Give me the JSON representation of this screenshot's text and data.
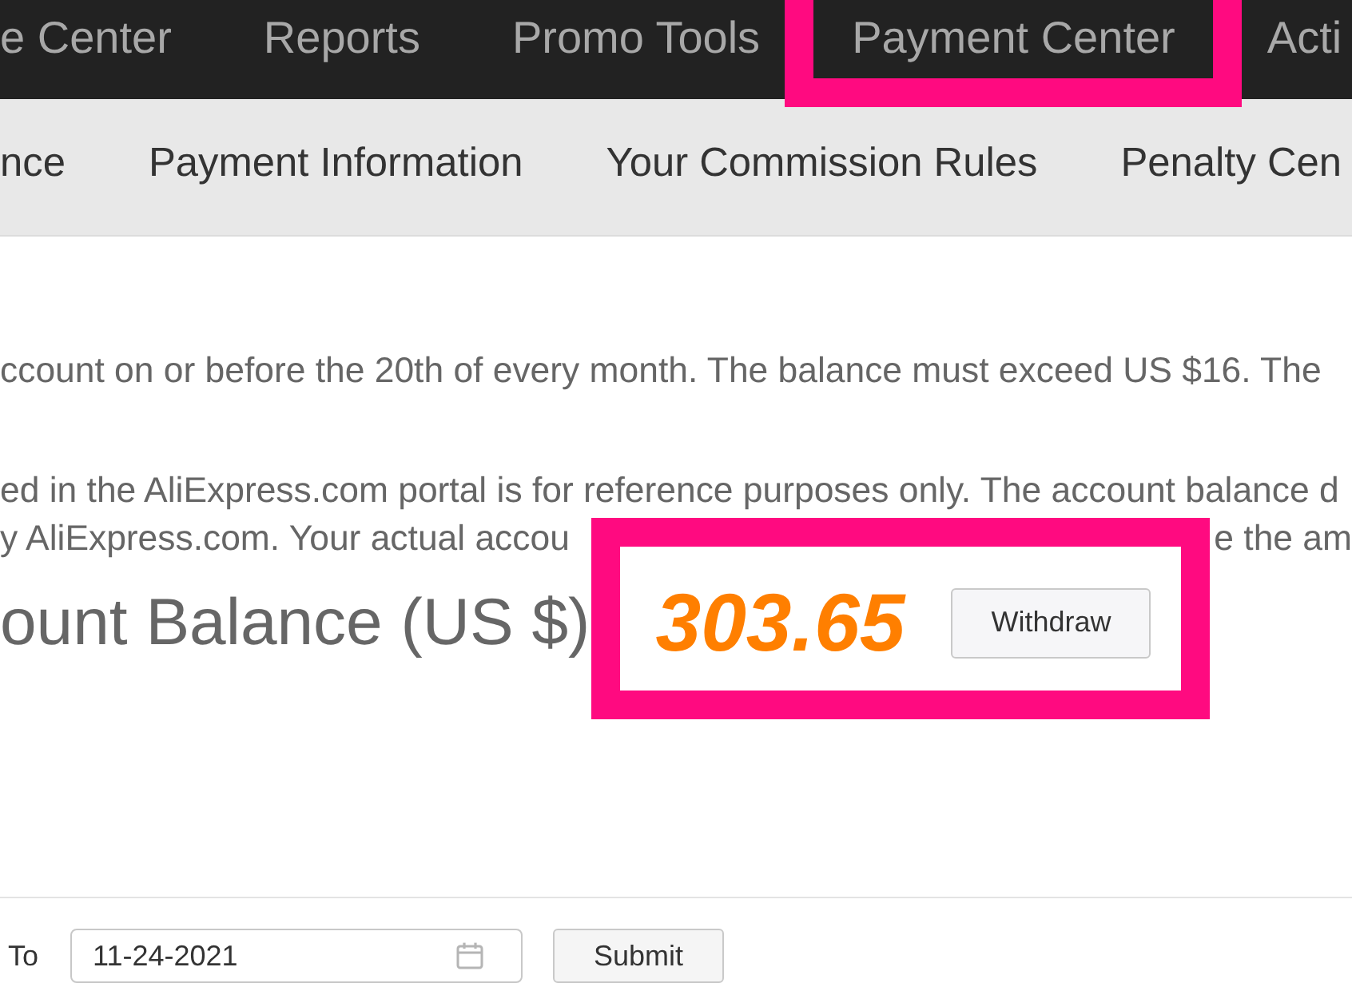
{
  "top_nav": {
    "items": [
      {
        "label": "e Center",
        "highlighted": false
      },
      {
        "label": "Reports",
        "highlighted": false
      },
      {
        "label": "Promo Tools",
        "highlighted": false
      },
      {
        "label": "Payment Center",
        "highlighted": true
      },
      {
        "label": "Acti",
        "highlighted": false
      }
    ]
  },
  "sub_nav": {
    "items": [
      "nce",
      "Payment Information",
      "Your Commission Rules",
      "Penalty Cen"
    ]
  },
  "notices": [
    {
      "lines": [
        [
          "ccount on or before the 20th of every month. The balance must exceed US $16. The"
        ]
      ]
    },
    {
      "lines": [
        [
          "ed in the AliExpress.com portal is for reference purposes only. The account balance d"
        ],
        [
          "y AliExpress.com. Your actual accou",
          "e the am"
        ]
      ]
    }
  ],
  "balance": {
    "label": "ount Balance (US $)",
    "amount": "303.65",
    "button": "Withdraw",
    "highlighted": true
  },
  "date_filter": {
    "label": "To",
    "value": "11-24-2021",
    "button": "Submit"
  }
}
